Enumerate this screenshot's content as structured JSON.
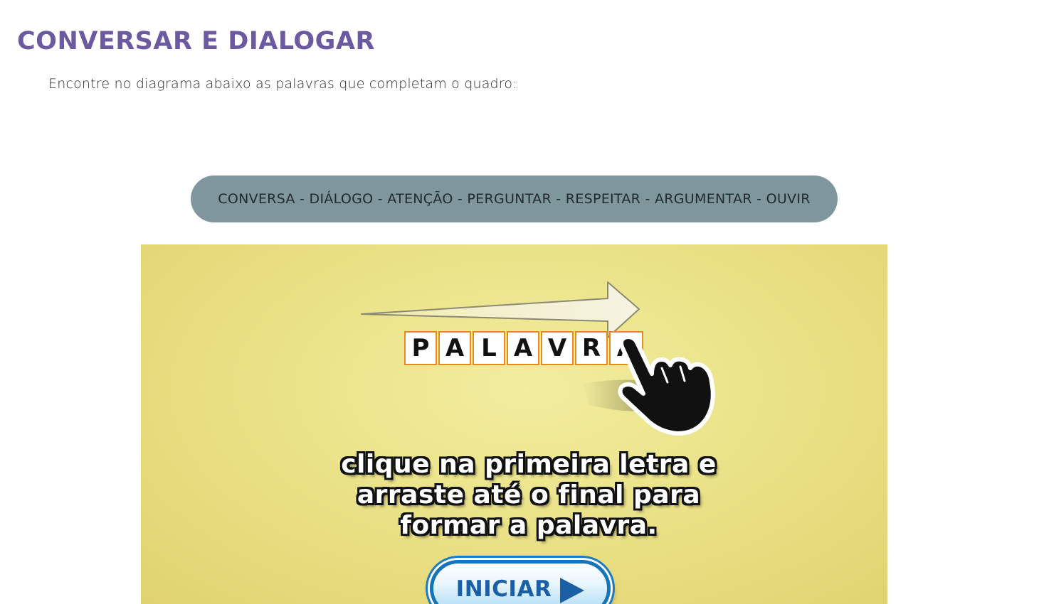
{
  "header": {
    "title": "CONVERSAR E DIALOGAR",
    "instruction": "Encontre no diagrama abaixo as palavras que completam o quadro:"
  },
  "word_bank": {
    "text": "CONVERSA - DIÁLOGO - ATENÇÃO - PERGUNTAR - RESPEITAR - ARGUMENTAR - OUVIR"
  },
  "game": {
    "demo_letters": [
      "P",
      "A",
      "L",
      "A",
      "V",
      "R",
      "A"
    ],
    "caption_lines": [
      "clique na primeira letra e",
      "arraste até o final para",
      "formar a palavra."
    ],
    "start_button_label": "INICIAR",
    "icons": {
      "arrow": "right-arrow-icon",
      "pointer": "pointing-hand-icon",
      "play": "play-icon"
    }
  },
  "colors": {
    "title": "#6b5aa0",
    "word_bank_bg": "#7f969d",
    "game_bg": "#ece58d",
    "letter_border": "#e88a1f",
    "button_blue": "#1b5fa6"
  }
}
